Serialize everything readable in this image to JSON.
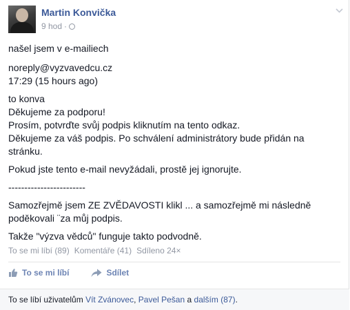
{
  "post": {
    "author": "Martin Konvička",
    "time": "9 hod",
    "separator": "·",
    "body": {
      "intro": "našel jsem v e-mailiech",
      "email_from": "noreply@vyzvavedcu.cz",
      "email_time": "17:29 (15 hours ago)",
      "email_to": "to konva",
      "line_thanks": "Děkujeme za podporu!",
      "line_confirm": "Prosím, potvrďte svůj podpis kliknutím na tento odkaz.",
      "line_approval": "Děkujeme za váš podpis. Po schválení administrátory bude přidán na stránku.",
      "line_ignore": "Pokud jste tento e-mail nevyžádali, prostě jej ignorujte.",
      "dashes": "------------------------",
      "comment": "Samozřejmě jsem ZE ZVĚDAVOSTI klikl ... a samozřejmě mi následně poděkovali ¨za můj podpis.",
      "conclusion": "Takže \"výzva vědců\" funguje takto podvodně."
    }
  },
  "stats": {
    "likes": "To se mi líbí (89)",
    "comments": "Komentáře (41)",
    "shares": "Sdíleno 24×"
  },
  "actions": {
    "like": "To se mi líbí",
    "share": "Sdílet"
  },
  "likes_bar": {
    "prefix": "To se líbí uživatelům",
    "user1": "Vít Zvánovec",
    "comma": ",",
    "user2": "Pavel Pešan",
    "conj": "a",
    "others": "dalším (87)",
    "period": "."
  },
  "icons": {
    "privacy": "globe-icon",
    "menu": "chevron-down-icon",
    "like": "thumbs-up-icon",
    "share": "share-arrow-icon"
  },
  "colors": {
    "link": "#3b5998",
    "action": "#6d84b4",
    "meta": "#9197a3",
    "likes_bar_bg": "#f6f7f9"
  }
}
